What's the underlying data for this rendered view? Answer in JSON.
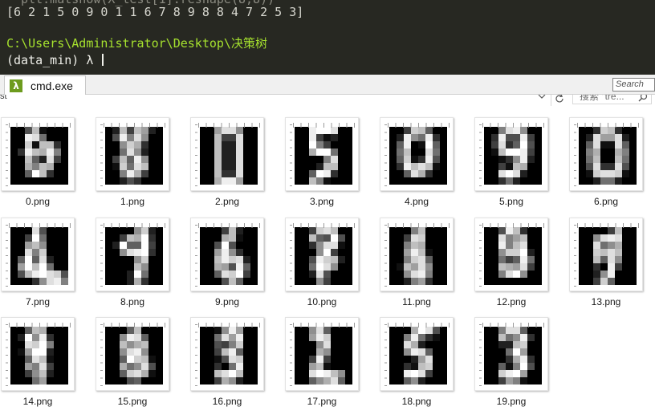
{
  "terminal": {
    "faded_line": "  plt.matshow(X_test[1].reshape(8,8))",
    "output_line": "[6 2 1 5 0 9 0 1 1 6 7 8 9 8 8 4 7 2 5 3]",
    "path_line": "C:\\Users\\Administrator\\Desktop\\决策树",
    "prompt_line": "(data_min) λ "
  },
  "cmder": {
    "tab_icon": "λ",
    "tab_label": "cmd.exe",
    "search_placeholder": "Search"
  },
  "explorer": {
    "breadcrumb_tail": "st",
    "search_placeholder": "搜索 \"tre...",
    "icons": [
      "chevron-down-icon",
      "refresh-icon",
      "search-icon"
    ],
    "files": [
      {
        "name": "0.png",
        "digit": [
          0,
          0,
          5,
          12,
          1,
          0,
          0,
          0,
          0,
          0,
          15,
          14,
          7,
          0,
          0,
          0,
          0,
          0,
          13,
          1,
          12,
          12,
          3,
          0,
          0,
          3,
          15,
          12,
          11,
          15,
          8,
          0,
          0,
          0,
          12,
          6,
          2,
          14,
          4,
          0,
          0,
          0,
          11,
          8,
          12,
          11,
          0,
          0,
          0,
          0,
          6,
          16,
          12,
          3,
          0,
          0,
          0,
          0,
          0,
          0,
          0,
          0,
          0,
          0
        ]
      },
      {
        "name": "1.png",
        "digit": [
          0,
          2,
          12,
          4,
          12,
          10,
          2,
          0,
          0,
          5,
          15,
          8,
          14,
          9,
          0,
          0,
          0,
          0,
          9,
          13,
          11,
          3,
          0,
          0,
          0,
          0,
          7,
          14,
          9,
          2,
          0,
          0,
          0,
          4,
          12,
          6,
          15,
          9,
          0,
          0,
          0,
          1,
          13,
          7,
          14,
          12,
          0,
          0,
          0,
          0,
          8,
          15,
          11,
          4,
          0,
          0,
          0,
          0,
          2,
          5,
          3,
          0,
          0,
          0
        ]
      },
      {
        "name": "2.png",
        "digit": [
          0,
          0,
          10,
          14,
          14,
          9,
          0,
          0,
          0,
          0,
          12,
          4,
          4,
          14,
          0,
          0,
          0,
          0,
          12,
          2,
          2,
          14,
          0,
          0,
          0,
          0,
          12,
          2,
          2,
          14,
          0,
          0,
          0,
          0,
          12,
          2,
          2,
          14,
          0,
          0,
          0,
          0,
          12,
          2,
          2,
          14,
          0,
          0,
          0,
          0,
          12,
          3,
          3,
          14,
          0,
          0,
          0,
          0,
          11,
          15,
          15,
          10,
          0,
          0
        ]
      },
      {
        "name": "3.png",
        "digit": [
          0,
          0,
          15,
          16,
          16,
          14,
          0,
          0,
          0,
          0,
          15,
          4,
          1,
          2,
          0,
          0,
          0,
          0,
          16,
          8,
          4,
          0,
          0,
          0,
          0,
          0,
          11,
          16,
          16,
          7,
          0,
          0,
          0,
          0,
          0,
          0,
          8,
          14,
          0,
          0,
          0,
          0,
          0,
          2,
          12,
          12,
          0,
          0,
          0,
          0,
          6,
          16,
          15,
          3,
          0,
          0,
          0,
          0,
          12,
          8,
          1,
          0,
          0,
          0
        ]
      },
      {
        "name": "4.png",
        "digit": [
          0,
          0,
          4,
          13,
          12,
          6,
          0,
          0,
          0,
          2,
          15,
          9,
          7,
          15,
          3,
          0,
          0,
          6,
          15,
          0,
          1,
          16,
          6,
          0,
          0,
          7,
          12,
          0,
          0,
          14,
          7,
          0,
          0,
          6,
          13,
          1,
          3,
          15,
          5,
          0,
          0,
          3,
          15,
          12,
          14,
          12,
          1,
          0,
          0,
          0,
          6,
          14,
          11,
          3,
          0,
          0,
          0,
          0,
          0,
          0,
          0,
          0,
          0,
          0
        ]
      },
      {
        "name": "5.png",
        "digit": [
          0,
          0,
          8,
          14,
          15,
          9,
          0,
          0,
          0,
          3,
          15,
          5,
          5,
          15,
          4,
          0,
          0,
          4,
          14,
          3,
          6,
          16,
          5,
          0,
          0,
          1,
          12,
          16,
          16,
          15,
          4,
          0,
          0,
          0,
          1,
          3,
          9,
          15,
          2,
          0,
          0,
          0,
          4,
          1,
          12,
          11,
          0,
          0,
          0,
          0,
          14,
          16,
          14,
          2,
          0,
          0,
          0,
          0,
          3,
          7,
          2,
          0,
          0,
          0
        ]
      },
      {
        "name": "6.png",
        "digit": [
          0,
          0,
          3,
          13,
          12,
          3,
          0,
          0,
          0,
          2,
          14,
          10,
          10,
          14,
          2,
          0,
          0,
          6,
          14,
          1,
          1,
          14,
          6,
          0,
          0,
          8,
          11,
          0,
          0,
          11,
          8,
          0,
          0,
          7,
          12,
          0,
          0,
          12,
          7,
          0,
          0,
          5,
          14,
          3,
          3,
          14,
          5,
          0,
          0,
          1,
          13,
          14,
          14,
          13,
          1,
          0,
          0,
          0,
          2,
          7,
          7,
          2,
          0,
          0
        ]
      },
      {
        "name": "7.png",
        "digit": [
          0,
          0,
          0,
          14,
          5,
          0,
          0,
          0,
          0,
          0,
          4,
          16,
          7,
          0,
          0,
          0,
          0,
          0,
          10,
          12,
          9,
          0,
          0,
          0,
          0,
          0,
          14,
          8,
          13,
          0,
          0,
          0,
          0,
          6,
          16,
          6,
          14,
          2,
          0,
          0,
          0,
          10,
          16,
          12,
          16,
          7,
          0,
          0,
          0,
          5,
          12,
          15,
          16,
          14,
          13,
          5,
          0,
          0,
          0,
          3,
          9,
          14,
          15,
          8
        ]
      },
      {
        "name": "8.png",
        "digit": [
          0,
          0,
          0,
          0,
          9,
          13,
          2,
          0,
          0,
          0,
          4,
          12,
          11,
          16,
          3,
          0,
          0,
          2,
          16,
          6,
          6,
          16,
          4,
          0,
          0,
          0,
          9,
          14,
          15,
          16,
          3,
          0,
          0,
          0,
          0,
          0,
          9,
          13,
          0,
          0,
          0,
          0,
          0,
          0,
          12,
          9,
          0,
          0,
          0,
          0,
          0,
          2,
          16,
          7,
          0,
          0,
          0,
          0,
          0,
          2,
          11,
          3,
          0,
          0
        ]
      },
      {
        "name": "9.png",
        "digit": [
          0,
          0,
          0,
          4,
          12,
          2,
          0,
          0,
          0,
          0,
          0,
          11,
          12,
          1,
          0,
          0,
          0,
          0,
          5,
          16,
          5,
          0,
          0,
          0,
          0,
          0,
          10,
          15,
          9,
          3,
          0,
          0,
          0,
          0,
          12,
          15,
          13,
          14,
          2,
          0,
          0,
          0,
          11,
          10,
          5,
          15,
          6,
          0,
          0,
          0,
          6,
          14,
          13,
          16,
          4,
          0,
          0,
          0,
          0,
          5,
          12,
          6,
          0,
          0
        ]
      },
      {
        "name": "10.png",
        "digit": [
          0,
          0,
          4,
          13,
          14,
          12,
          0,
          0,
          0,
          0,
          12,
          6,
          5,
          16,
          5,
          0,
          0,
          0,
          3,
          9,
          14,
          14,
          1,
          0,
          0,
          0,
          0,
          9,
          16,
          4,
          0,
          0,
          0,
          0,
          5,
          15,
          13,
          12,
          2,
          0,
          0,
          0,
          7,
          16,
          14,
          9,
          0,
          0,
          0,
          0,
          2,
          14,
          5,
          0,
          0,
          0,
          0,
          0,
          0,
          9,
          4,
          0,
          0,
          0
        ]
      },
      {
        "name": "11.png",
        "digit": [
          0,
          0,
          0,
          8,
          12,
          0,
          0,
          0,
          0,
          0,
          4,
          14,
          13,
          0,
          0,
          0,
          0,
          0,
          8,
          12,
          11,
          0,
          0,
          0,
          0,
          0,
          10,
          15,
          12,
          1,
          0,
          0,
          0,
          0,
          8,
          13,
          14,
          6,
          0,
          0,
          0,
          1,
          12,
          10,
          14,
          9,
          0,
          0,
          0,
          0,
          9,
          14,
          15,
          8,
          0,
          0,
          0,
          0,
          2,
          8,
          10,
          3,
          0,
          0
        ]
      },
      {
        "name": "12.png",
        "digit": [
          0,
          0,
          5,
          15,
          12,
          3,
          0,
          0,
          0,
          0,
          14,
          8,
          10,
          12,
          0,
          0,
          0,
          0,
          15,
          8,
          12,
          14,
          0,
          0,
          0,
          0,
          9,
          13,
          13,
          16,
          2,
          0,
          0,
          0,
          7,
          4,
          6,
          15,
          7,
          0,
          0,
          0,
          12,
          11,
          10,
          14,
          4,
          0,
          0,
          0,
          8,
          14,
          16,
          9,
          0,
          0,
          0,
          0,
          0,
          0,
          0,
          0,
          0,
          0
        ]
      },
      {
        "name": "13.png",
        "digit": [
          0,
          0,
          0,
          0,
          4,
          12,
          0,
          0,
          0,
          0,
          9,
          14,
          15,
          14,
          0,
          0,
          0,
          0,
          14,
          7,
          9,
          11,
          0,
          0,
          0,
          0,
          13,
          12,
          14,
          12,
          0,
          0,
          0,
          0,
          12,
          6,
          14,
          9,
          0,
          0,
          0,
          0,
          3,
          0,
          15,
          4,
          0,
          0,
          0,
          0,
          2,
          9,
          15,
          0,
          0,
          0,
          0,
          0,
          4,
          13,
          6,
          0,
          0,
          0
        ]
      },
      {
        "name": "14.png",
        "digit": [
          0,
          0,
          6,
          12,
          11,
          0,
          0,
          0,
          0,
          2,
          16,
          9,
          15,
          3,
          0,
          0,
          0,
          0,
          14,
          13,
          16,
          8,
          0,
          0,
          0,
          1,
          10,
          16,
          16,
          2,
          0,
          0,
          0,
          0,
          6,
          14,
          12,
          1,
          0,
          0,
          0,
          0,
          10,
          8,
          14,
          4,
          0,
          0,
          0,
          0,
          4,
          9,
          12,
          2,
          0,
          0,
          0,
          0,
          0,
          7,
          10,
          0,
          0,
          0
        ]
      },
      {
        "name": "15.png",
        "digit": [
          0,
          0,
          0,
          6,
          12,
          0,
          0,
          0,
          0,
          0,
          9,
          15,
          14,
          6,
          0,
          0,
          0,
          0,
          12,
          9,
          11,
          12,
          0,
          0,
          0,
          0,
          9,
          14,
          15,
          9,
          0,
          0,
          0,
          0,
          6,
          16,
          13,
          12,
          1,
          0,
          0,
          0,
          11,
          7,
          9,
          14,
          5,
          0,
          0,
          0,
          6,
          13,
          14,
          11,
          1,
          0,
          0,
          0,
          0,
          5,
          6,
          0,
          0,
          0
        ]
      },
      {
        "name": "16.png",
        "digit": [
          0,
          0,
          1,
          9,
          15,
          10,
          0,
          0,
          0,
          0,
          7,
          14,
          10,
          15,
          0,
          0,
          0,
          0,
          5,
          4,
          8,
          13,
          0,
          0,
          0,
          0,
          4,
          12,
          15,
          6,
          0,
          0,
          0,
          0,
          1,
          5,
          14,
          13,
          0,
          0,
          0,
          0,
          3,
          0,
          7,
          15,
          0,
          0,
          0,
          0,
          12,
          14,
          16,
          12,
          0,
          0,
          0,
          0,
          4,
          11,
          9,
          2,
          0,
          0
        ]
      },
      {
        "name": "17.png",
        "digit": [
          0,
          0,
          9,
          14,
          6,
          0,
          0,
          0,
          0,
          0,
          10,
          15,
          13,
          0,
          0,
          0,
          0,
          0,
          0,
          9,
          14,
          0,
          0,
          0,
          0,
          0,
          0,
          11,
          9,
          0,
          0,
          0,
          0,
          0,
          4,
          15,
          4,
          0,
          0,
          0,
          0,
          0,
          10,
          12,
          1,
          0,
          0,
          0,
          0,
          0,
          14,
          16,
          15,
          12,
          9,
          0,
          0,
          0,
          6,
          9,
          11,
          14,
          6,
          0
        ]
      },
      {
        "name": "18.png",
        "digit": [
          0,
          0,
          0,
          11,
          16,
          14,
          5,
          0,
          0,
          0,
          8,
          15,
          7,
          3,
          1,
          0,
          0,
          0,
          14,
          11,
          2,
          0,
          0,
          0,
          0,
          0,
          9,
          15,
          14,
          6,
          0,
          0,
          0,
          0,
          0,
          2,
          10,
          14,
          0,
          0,
          0,
          0,
          3,
          1,
          12,
          13,
          0,
          0,
          0,
          0,
          15,
          16,
          14,
          4,
          0,
          0,
          0,
          0,
          6,
          9,
          2,
          0,
          0,
          0
        ]
      },
      {
        "name": "19.png",
        "digit": [
          0,
          0,
          8,
          14,
          14,
          6,
          0,
          0,
          0,
          0,
          12,
          7,
          9,
          15,
          3,
          0,
          0,
          0,
          2,
          2,
          12,
          13,
          0,
          0,
          0,
          0,
          0,
          7,
          16,
          10,
          0,
          0,
          0,
          0,
          0,
          3,
          11,
          15,
          3,
          0,
          0,
          0,
          6,
          1,
          8,
          16,
          5,
          0,
          0,
          0,
          13,
          15,
          16,
          10,
          0,
          0,
          0,
          0,
          4,
          10,
          8,
          1,
          0,
          0
        ]
      }
    ]
  },
  "colors": {
    "terminal_bg": "#272822",
    "terminal_path": "#a6e22e",
    "tab_icon_bg": "#6d9b1e",
    "window_bg": "#ffffff"
  }
}
